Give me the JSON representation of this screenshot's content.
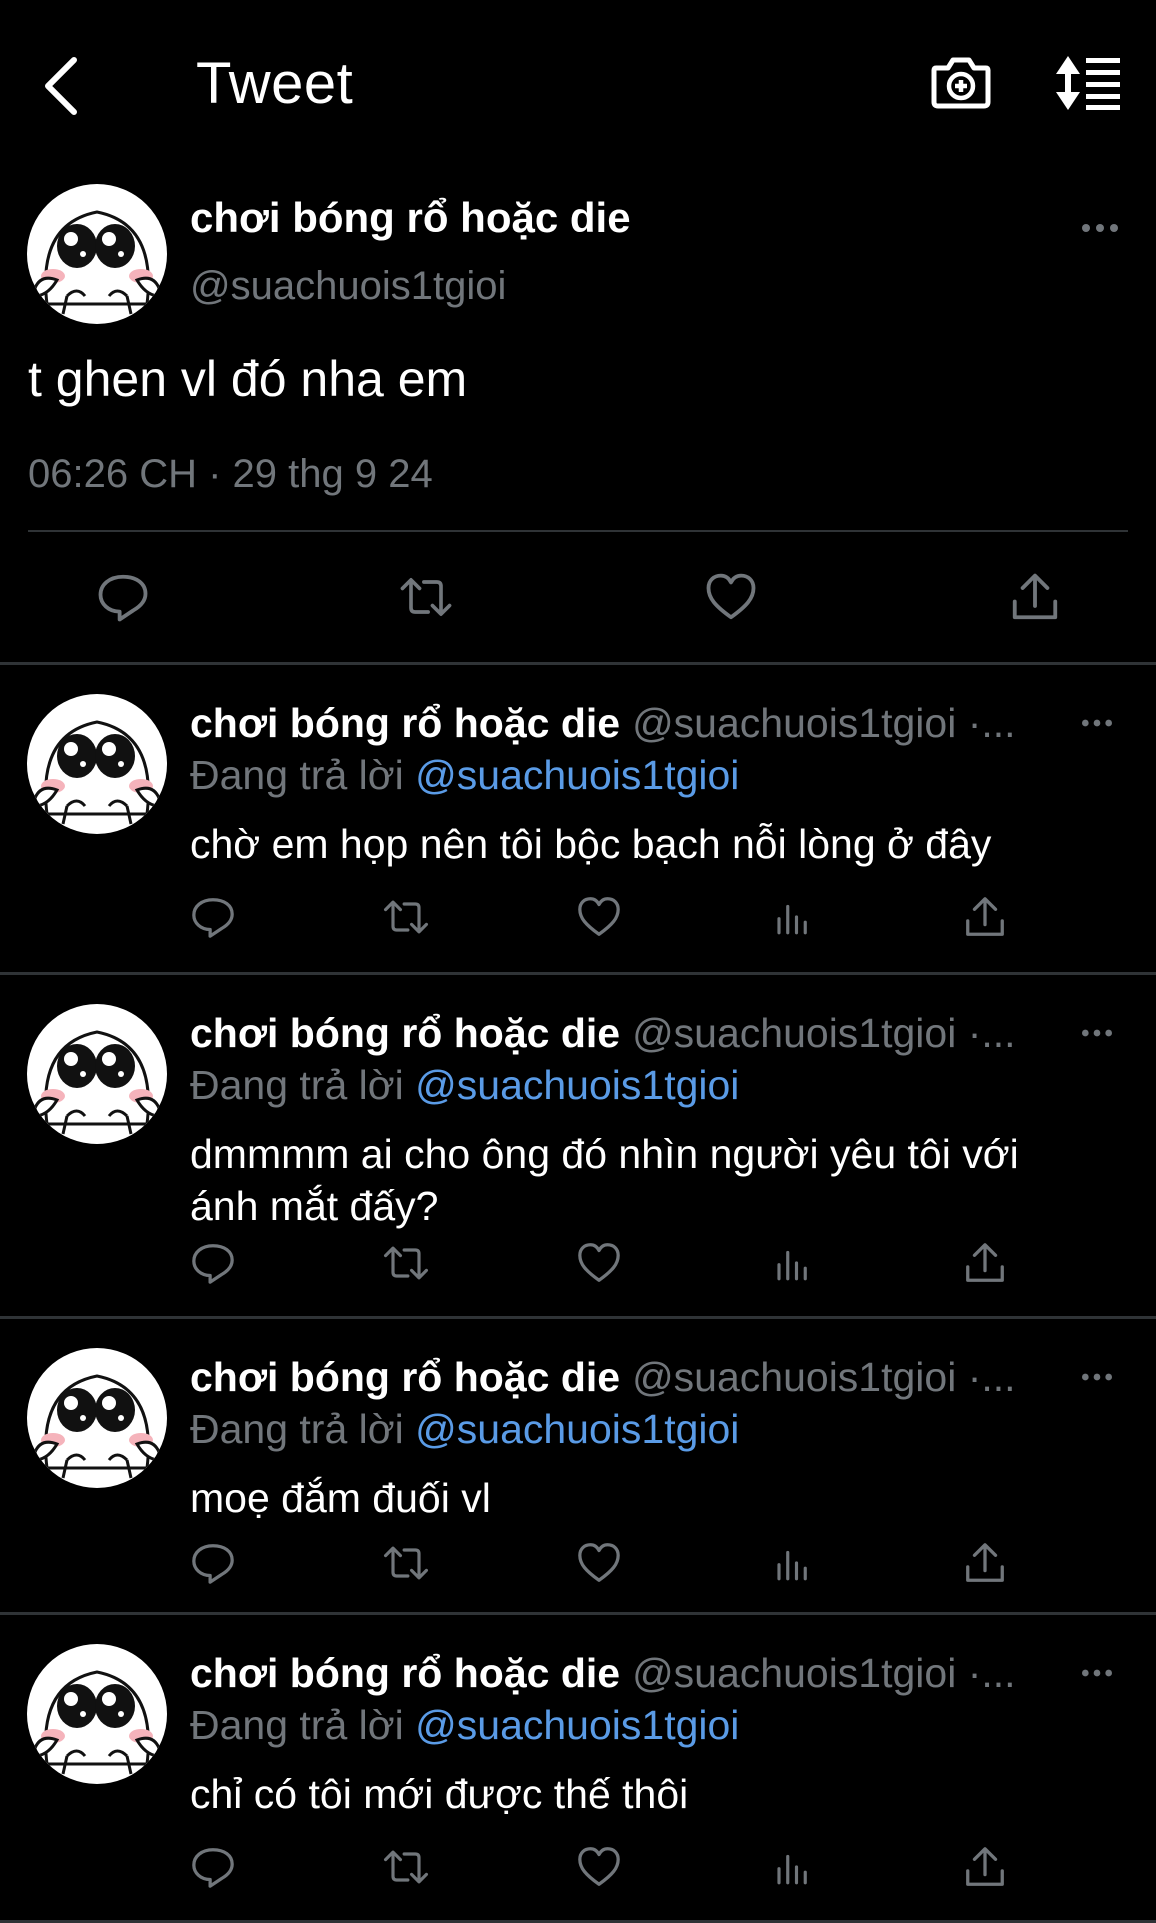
{
  "header": {
    "title": "Tweet",
    "back_icon": "chevron-left-icon",
    "camera_icon": "camera-plus-icon",
    "sort_icon": "sort-list-icon"
  },
  "main_tweet": {
    "name": "chơi bóng rổ hoặc die",
    "handle": "@suachuois1tgioi",
    "text": "t ghen vl đó nha em",
    "timestamp": "06:26 CH · 29 thg 9 24"
  },
  "replies": [
    {
      "name": "chơi bóng rổ hoặc die",
      "handle": "@suachuois1tgioi ·...",
      "replying_label": "Đang trả lời",
      "replying_to": "@suachuois1tgioi",
      "text": "chờ em họp nên tôi bộc bạch nỗi lòng ở đây"
    },
    {
      "name": "chơi bóng rổ hoặc die",
      "handle": "@suachuois1tgioi ·...",
      "replying_label": "Đang trả lời",
      "replying_to": "@suachuois1tgioi",
      "text": "dmmmm ai cho ông đó nhìn người yêu tôi với ánh mắt đấy?"
    },
    {
      "name": "chơi bóng rổ hoặc die",
      "handle": "@suachuois1tgioi ·...",
      "replying_label": "Đang trả lời",
      "replying_to": "@suachuois1tgioi",
      "text": "moẹ đắm đuối vl"
    },
    {
      "name": "chơi bóng rổ hoặc die",
      "handle": "@suachuois1tgioi ·...",
      "replying_label": "Đang trả lời",
      "replying_to": "@suachuois1tgioi",
      "text": "chỉ có tôi mới được thế thôi"
    }
  ],
  "colors": {
    "background": "#000000",
    "text": "#ffffff",
    "muted": "#71767b",
    "link": "#5a9be6",
    "divider": "#2f3336"
  }
}
